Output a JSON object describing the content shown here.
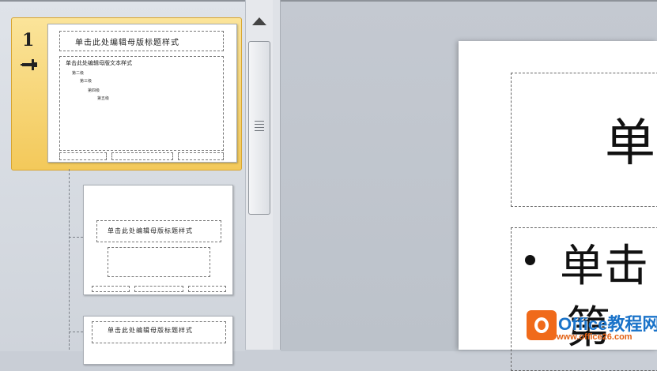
{
  "thumbnails": {
    "selected_number": "1",
    "slide1": {
      "title": "单击此处编辑母版标题样式",
      "body": "单击此处编辑母版文本样式",
      "levels": [
        "第二级",
        "第三级",
        "第四级",
        "第五级"
      ]
    },
    "slide2": {
      "title": "单击此处编辑母版标题样式"
    },
    "slide3": {
      "title": "单击此处编辑母版标题样式"
    }
  },
  "main_slide": {
    "title_fragment": "单",
    "bullet_fragment": "单击",
    "bullet_fragment_2": "第"
  },
  "watermark": {
    "brand": "Office教程网",
    "url": "www.office26.com",
    "brand_color": "#1a73c9",
    "logo_color": "#f06a1a"
  }
}
